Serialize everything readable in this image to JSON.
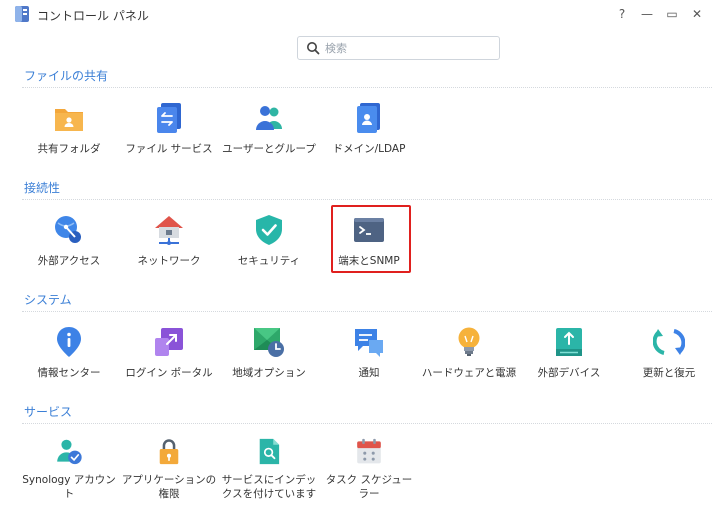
{
  "window": {
    "title": "コントロール パネル",
    "controls": {
      "help": "?",
      "minimize": "—",
      "maximize": "▭",
      "close": "✕"
    }
  },
  "search": {
    "placeholder": "検索",
    "value": ""
  },
  "sections": [
    {
      "title": "ファイルの共有",
      "items": [
        {
          "label": "共有フォルダ",
          "icon": "shared-folder-icon"
        },
        {
          "label": "ファイル サービス",
          "icon": "file-services-icon"
        },
        {
          "label": "ユーザーとグループ",
          "icon": "users-groups-icon"
        },
        {
          "label": "ドメイン/LDAP",
          "icon": "domain-ldap-icon"
        }
      ]
    },
    {
      "title": "接続性",
      "items": [
        {
          "label": "外部アクセス",
          "icon": "external-access-icon"
        },
        {
          "label": "ネットワーク",
          "icon": "network-icon"
        },
        {
          "label": "セキュリティ",
          "icon": "security-shield-icon"
        },
        {
          "label": "端末とSNMP",
          "icon": "terminal-icon",
          "highlighted": true
        }
      ]
    },
    {
      "title": "システム",
      "items": [
        {
          "label": "情報センター",
          "icon": "info-center-icon"
        },
        {
          "label": "ログイン ポータル",
          "icon": "login-portal-icon"
        },
        {
          "label": "地域オプション",
          "icon": "regional-options-icon"
        },
        {
          "label": "通知",
          "icon": "notification-icon"
        },
        {
          "label": "ハードウェアと電源",
          "icon": "hardware-power-icon"
        },
        {
          "label": "外部デバイス",
          "icon": "external-devices-icon"
        },
        {
          "label": "更新と復元",
          "icon": "update-restore-icon"
        }
      ]
    },
    {
      "title": "サービス",
      "items": [
        {
          "label": "Synology アカウント",
          "icon": "synology-account-icon"
        },
        {
          "label": "アプリケーションの権限",
          "icon": "app-privileges-icon"
        },
        {
          "label": "サービスにインデックスを付けています",
          "icon": "indexing-service-icon"
        },
        {
          "label": "タスク スケジューラー",
          "icon": "task-scheduler-icon"
        }
      ]
    }
  ],
  "colors": {
    "accent": "#3b7fd6",
    "highlight": "#e0201e"
  }
}
